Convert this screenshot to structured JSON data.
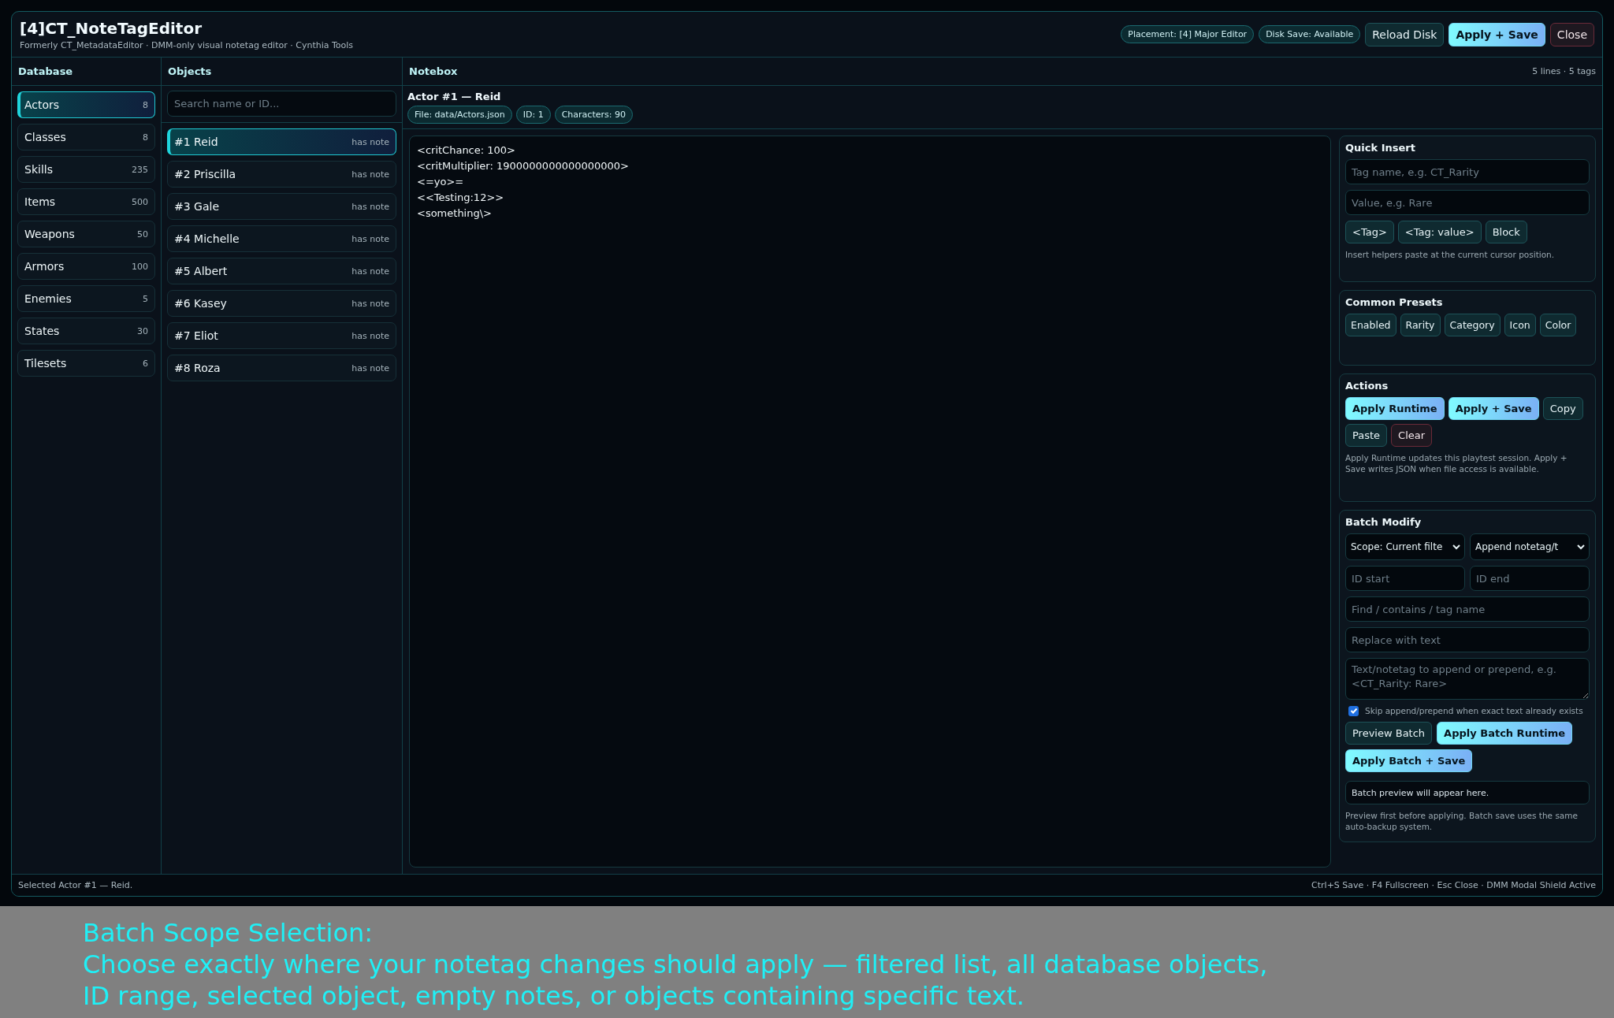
{
  "header": {
    "title": "[4]CT_NoteTagEditor",
    "subtitle": "Formerly CT_MetadataEditor · DMM-only visual notetag editor · Cynthia Tools",
    "badges": [
      "Placement: [4] Major Editor",
      "Disk Save: Available"
    ],
    "buttons": [
      {
        "label": "Reload Disk",
        "kind": "default"
      },
      {
        "label": "Apply + Save",
        "kind": "primary"
      },
      {
        "label": "Close",
        "kind": "danger"
      }
    ]
  },
  "database": {
    "title": "Database",
    "items": [
      {
        "label": "Actors",
        "count": "8",
        "selected": true
      },
      {
        "label": "Classes",
        "count": "8",
        "selected": false
      },
      {
        "label": "Skills",
        "count": "235",
        "selected": false
      },
      {
        "label": "Items",
        "count": "500",
        "selected": false
      },
      {
        "label": "Weapons",
        "count": "50",
        "selected": false
      },
      {
        "label": "Armors",
        "count": "100",
        "selected": false
      },
      {
        "label": "Enemies",
        "count": "5",
        "selected": false
      },
      {
        "label": "States",
        "count": "30",
        "selected": false
      },
      {
        "label": "Tilesets",
        "count": "6",
        "selected": false
      }
    ]
  },
  "objects": {
    "title": "Objects",
    "search": {
      "placeholder": "Search name or ID..."
    },
    "items": [
      {
        "label": "#1 Reid",
        "note": "has note",
        "selected": true
      },
      {
        "label": "#2 Priscilla",
        "note": "has note",
        "selected": false
      },
      {
        "label": "#3 Gale",
        "note": "has note",
        "selected": false
      },
      {
        "label": "#4 Michelle",
        "note": "has note",
        "selected": false
      },
      {
        "label": "#5 Albert",
        "note": "has note",
        "selected": false
      },
      {
        "label": "#6 Kasey",
        "note": "has note",
        "selected": false
      },
      {
        "label": "#7 Eliot",
        "note": "has note",
        "selected": false
      },
      {
        "label": "#8 Roza",
        "note": "has note",
        "selected": false
      }
    ]
  },
  "notebox": {
    "title": "Notebox",
    "summary": "5 lines · 5 tags",
    "object_title": "Actor #1 — Reid",
    "chips": [
      "File: data/Actors.json",
      "ID: 1",
      "Characters: 90"
    ],
    "lines": [
      "<critChance: 100>",
      "<critMultiplier: 1900000000000000000>",
      "<=yo>=",
      "<<Testing:12>>",
      "<something\\>"
    ]
  },
  "quick_insert": {
    "title": "Quick Insert",
    "fields": [
      {
        "placeholder": "Tag name, e.g. CT_Rarity"
      },
      {
        "placeholder": "Value, e.g. Rare"
      }
    ],
    "buttons": [
      {
        "label": "<Tag>",
        "kind": "default"
      },
      {
        "label": "<Tag: value>",
        "kind": "default"
      },
      {
        "label": "Block",
        "kind": "default"
      }
    ],
    "hint": "Insert helpers paste at the current cursor position."
  },
  "common_presets": {
    "title": "Common Presets",
    "buttons": [
      {
        "label": "Enabled",
        "kind": "default"
      },
      {
        "label": "Rarity",
        "kind": "default"
      },
      {
        "label": "Category",
        "kind": "default"
      },
      {
        "label": "Icon",
        "kind": "default"
      },
      {
        "label": "Color",
        "kind": "default"
      }
    ]
  },
  "actions": {
    "title": "Actions",
    "buttons": [
      {
        "label": "Apply Runtime",
        "kind": "primary"
      },
      {
        "label": "Apply + Save",
        "kind": "primary"
      },
      {
        "label": "Copy",
        "kind": "default"
      },
      {
        "label": "Paste",
        "kind": "default"
      },
      {
        "label": "Clear",
        "kind": "danger"
      }
    ],
    "hint": "Apply Runtime updates this playtest session. Apply + Save writes JSON when file access is available."
  },
  "batch_modify": {
    "title": "Batch Modify",
    "selects": [
      "Scope: Current filte",
      "Append notetag/t"
    ],
    "range_fields": [
      {
        "placeholder": "ID start"
      },
      {
        "placeholder": "ID end"
      }
    ],
    "fields": [
      {
        "placeholder": "Find / contains / tag name"
      },
      {
        "placeholder": "Replace with text"
      }
    ],
    "text_area": {
      "placeholder": "Text/notetag to append or prepend, e.g. <CT_Rarity: Rare>"
    },
    "skip_existing": {
      "label": "Skip append/prepend when exact text already exists",
      "checked": true
    },
    "buttons": [
      {
        "label": "Preview Batch",
        "kind": "default"
      },
      {
        "label": "Apply Batch Runtime",
        "kind": "primary"
      },
      {
        "label": "Apply Batch + Save",
        "kind": "primary"
      }
    ],
    "preview": "Batch preview will appear here.",
    "hint": "Preview first before applying. Batch save uses the same auto-backup system."
  },
  "status_bar": {
    "left": "Selected Actor #1 — Reid.",
    "right": "Ctrl+S Save · F4 Fullscreen · Esc Close · DMM Modal Shield Active"
  },
  "caption": {
    "title": "Batch Scope Selection:",
    "lines": [
      "Choose exactly where your notetag changes should apply — filtered list, all database objects,",
      "ID range, selected object, empty notes, or objects containing specific text."
    ]
  }
}
